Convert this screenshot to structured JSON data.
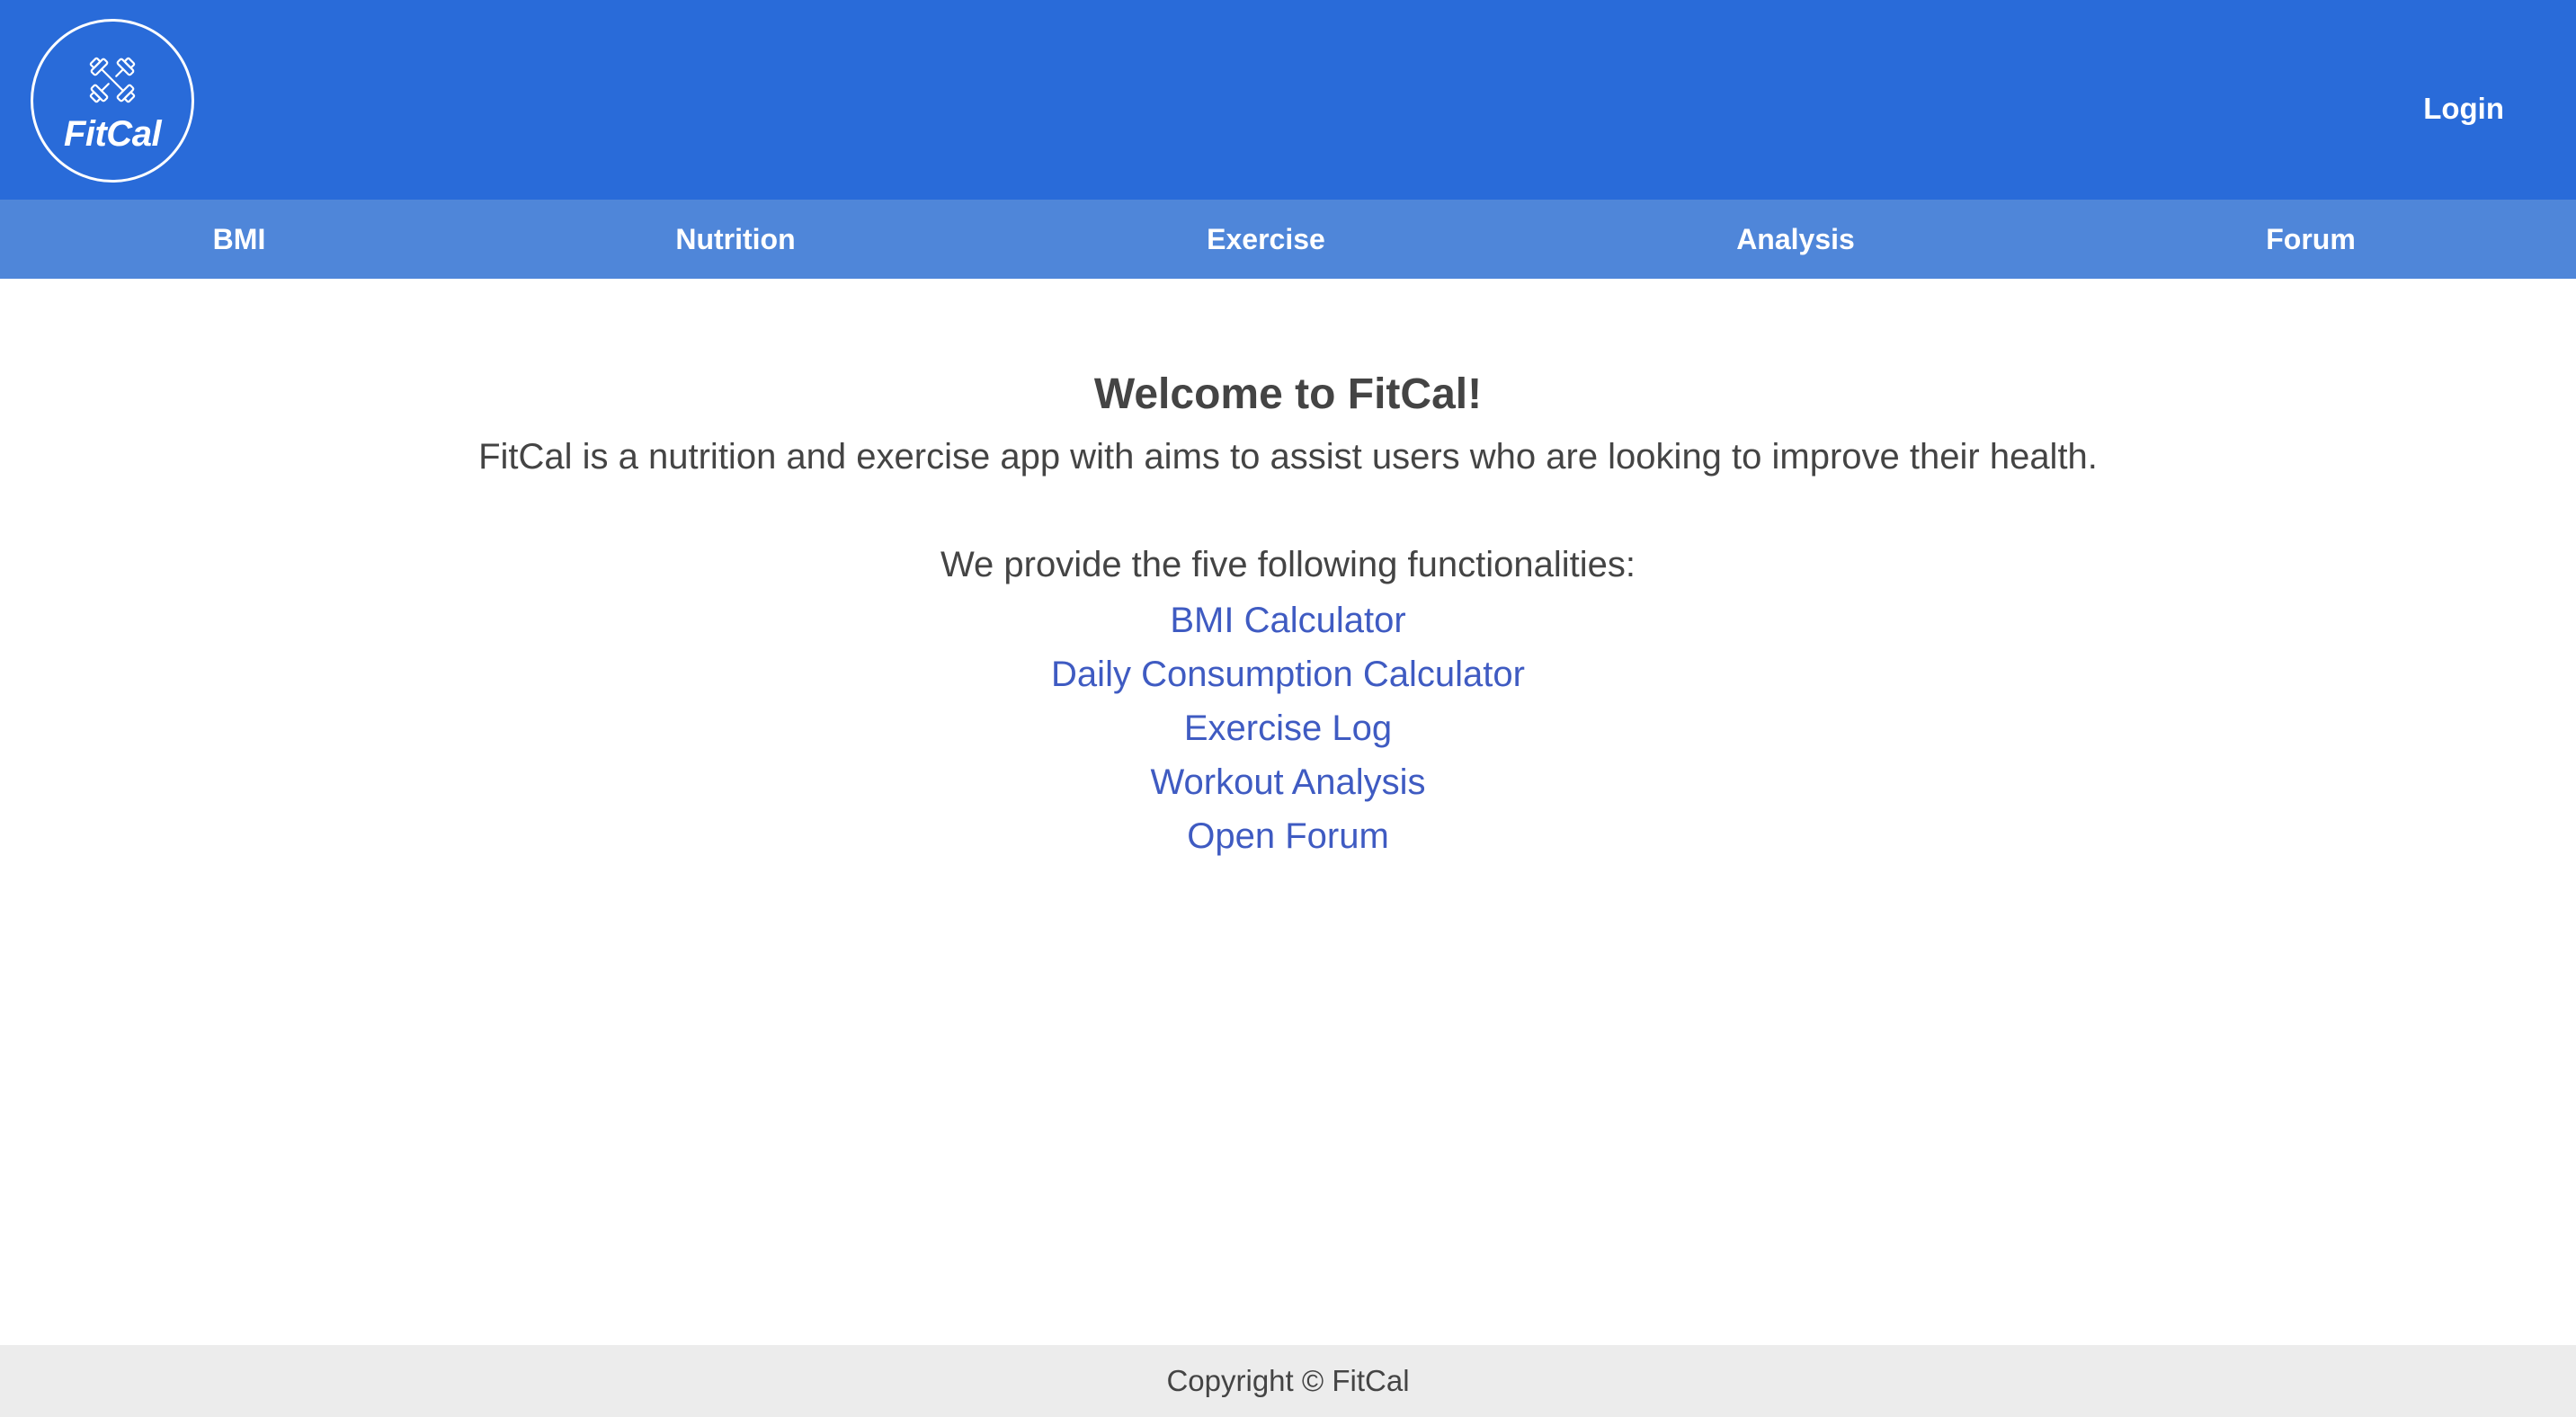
{
  "header": {
    "logo_text": "FitCal",
    "login_label": "Login",
    "brand_color": "#296bd9"
  },
  "nav": {
    "color": "#4f86d9",
    "items": [
      {
        "label": "BMI"
      },
      {
        "label": "Nutrition"
      },
      {
        "label": "Exercise"
      },
      {
        "label": "Analysis"
      },
      {
        "label": "Forum"
      }
    ]
  },
  "main": {
    "title": "Welcome to FitCal!",
    "intro": "FitCal is a nutrition and exercise app with aims to assist users who are looking to improve their health.",
    "features_heading": "We provide the five following functionalities:",
    "link_color": "#3f5bc2",
    "features": [
      {
        "label": "BMI Calculator"
      },
      {
        "label": "Daily Consumption Calculator"
      },
      {
        "label": "Exercise Log"
      },
      {
        "label": "Workout Analysis"
      },
      {
        "label": "Open Forum"
      }
    ]
  },
  "footer": {
    "copyright": "Copyright © FitCal"
  },
  "icons": {
    "logo": "dumbbells-icon"
  }
}
